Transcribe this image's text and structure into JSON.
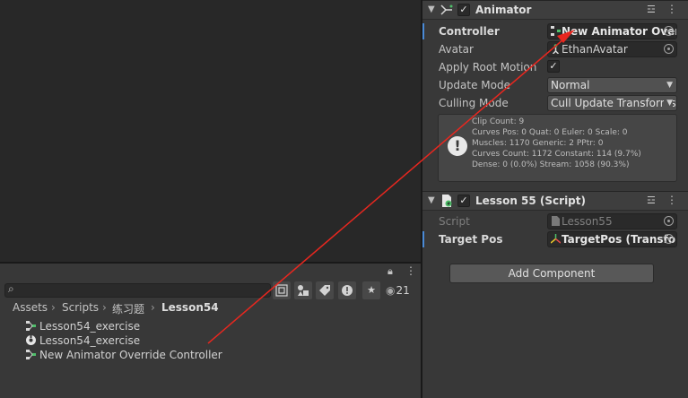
{
  "project": {
    "search_placeholder": "",
    "hidden_count": "21",
    "breadcrumb": [
      "Assets",
      "Scripts",
      "练习题",
      "Lesson54"
    ],
    "files": [
      {
        "name": "Lesson54_exercise",
        "icon": "animator-controller-icon"
      },
      {
        "name": "Lesson54_exercise",
        "icon": "prefab-icon"
      },
      {
        "name": "New Animator Override Controller",
        "icon": "animator-override-controller-icon"
      }
    ]
  },
  "inspector": {
    "animator": {
      "title": "Animator",
      "enabled": true,
      "controller_label": "Controller",
      "controller_value": "New Animator Override Controller",
      "avatar_label": "Avatar",
      "avatar_value": "EthanAvatar",
      "apply_root_motion_label": "Apply Root Motion",
      "apply_root_motion": true,
      "update_mode_label": "Update Mode",
      "update_mode_value": "Normal",
      "culling_mode_label": "Culling Mode",
      "culling_mode_value": "Cull Update Transforms",
      "info_lines": [
        "Clip Count: 9",
        "Curves Pos: 0 Quat: 0 Euler: 0 Scale: 0",
        "Muscles: 1170 Generic: 2 PPtr: 0",
        "Curves Count: 1172 Constant: 114 (9.7%)",
        "Dense: 0 (0.0%) Stream: 1058 (90.3%)"
      ]
    },
    "lesson": {
      "title": "Lesson 55 (Script)",
      "enabled": true,
      "script_label": "Script",
      "script_value": "Lesson55",
      "target_label": "Target Pos",
      "target_value": "TargetPos (Transform)"
    },
    "add_component_label": "Add Component"
  },
  "colors": {
    "annotation_arrow": "#e8271f",
    "selection_accent": "#4a8ad6"
  }
}
